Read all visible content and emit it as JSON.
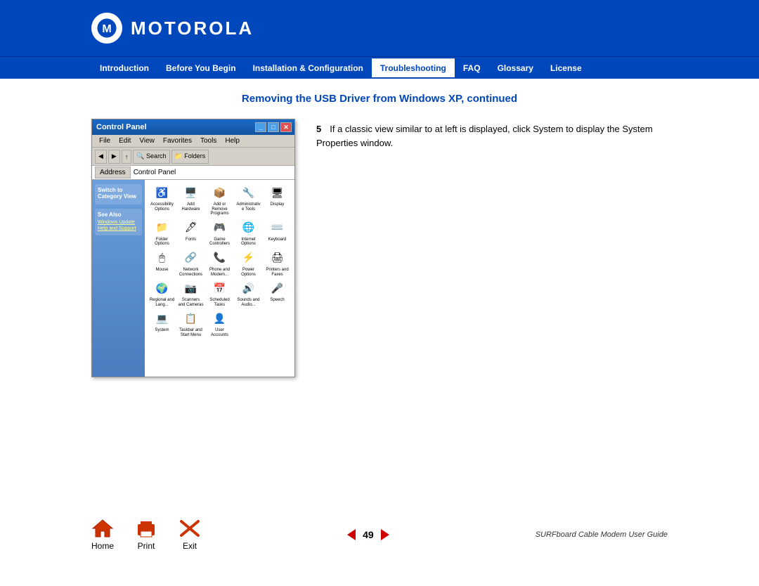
{
  "header": {
    "logo_text": "MOTOROLA",
    "background_color": "#0047bb"
  },
  "navbar": {
    "items": [
      {
        "label": "Introduction",
        "active": false
      },
      {
        "label": "Before You Begin",
        "active": false
      },
      {
        "label": "Installation & Configuration",
        "active": false
      },
      {
        "label": "Troubleshooting",
        "active": true
      },
      {
        "label": "FAQ",
        "active": false
      },
      {
        "label": "Glossary",
        "active": false
      },
      {
        "label": "License",
        "active": false
      }
    ]
  },
  "page": {
    "title": "Removing the USB Driver from Windows XP, continued",
    "step_number": "5",
    "step_text": "If a classic view similar to at left is displayed, click System to display the System Properties window.",
    "screenshot": {
      "title": "Control Panel",
      "menubar_items": [
        "File",
        "Edit",
        "View",
        "Favorites",
        "Tools",
        "Help"
      ],
      "address": "Control Panel",
      "sidebar_section1_title": "Switch to Category View",
      "sidebar_links": [
        "Windows Update",
        "Help and Support"
      ],
      "icons": [
        {
          "label": "Accessibility Options"
        },
        {
          "label": "Add Hardware"
        },
        {
          "label": "Add or Remove Programs"
        },
        {
          "label": "Administrative Tools"
        },
        {
          "label": "Display"
        },
        {
          "label": "Folder Options"
        },
        {
          "label": "Fonts"
        },
        {
          "label": "Game Controllers"
        },
        {
          "label": "Internet Options"
        },
        {
          "label": "Keyboard"
        },
        {
          "label": "Mouse"
        },
        {
          "label": "Network Connections"
        },
        {
          "label": "Phone and Modem..."
        },
        {
          "label": "Power Options"
        },
        {
          "label": "Printers and Faxes"
        },
        {
          "label": "Regional and Language..."
        },
        {
          "label": "Scanners and Cameras"
        },
        {
          "label": "Scheduled Tasks"
        },
        {
          "label": "Sounds and Audio Devices"
        },
        {
          "label": "Speech"
        },
        {
          "label": "System"
        },
        {
          "label": "Taskbar and Start Menu"
        },
        {
          "label": "User Accounts"
        }
      ]
    }
  },
  "footer": {
    "home_label": "Home",
    "print_label": "Print",
    "exit_label": "Exit",
    "page_number": "49",
    "guide_text": "SURFboard Cable Modem User Guide"
  }
}
